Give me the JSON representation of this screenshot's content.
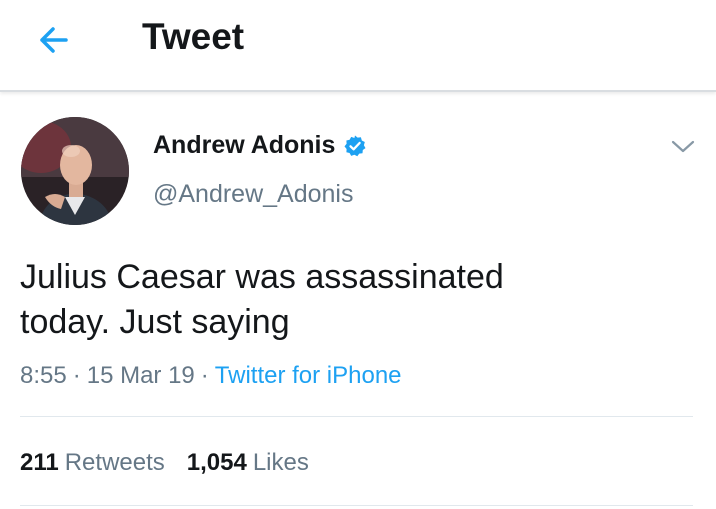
{
  "header": {
    "title": "Tweet",
    "back_icon": "back-arrow-icon",
    "accent": "#1da1f2"
  },
  "author": {
    "name": "Andrew Adonis",
    "handle": "@Andrew_Adonis",
    "verified_icon": "verified-badge-icon",
    "menu_icon": "chevron-down-icon"
  },
  "tweet": {
    "text_line1": "Julius Caesar was assassinated",
    "text_line2": "today. Just saying",
    "time": "8:55",
    "date": "15 Mar 19",
    "source": "Twitter for iPhone"
  },
  "stats": {
    "retweets_count": "211",
    "retweets_label": "Retweets",
    "likes_count": "1,054",
    "likes_label": "Likes"
  }
}
